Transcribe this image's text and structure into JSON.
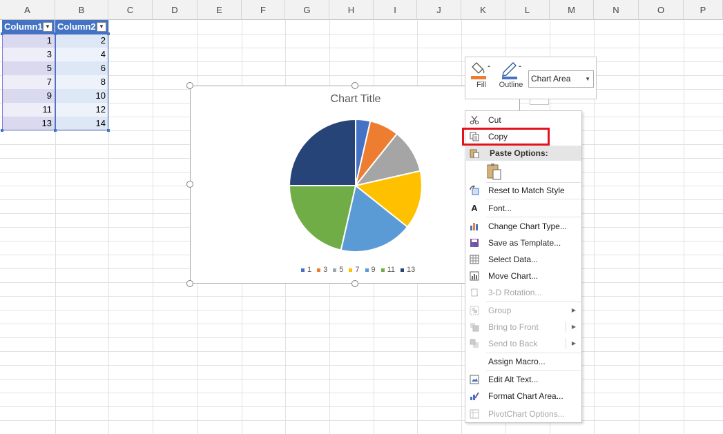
{
  "sheet": {
    "columns": [
      "A",
      "B",
      "C",
      "D",
      "E",
      "F",
      "G",
      "H",
      "I",
      "J",
      "K",
      "L",
      "M",
      "N",
      "O",
      "P"
    ]
  },
  "table": {
    "headers": [
      "Column1",
      "Column2"
    ],
    "rows": [
      [
        "1",
        "2"
      ],
      [
        "3",
        "4"
      ],
      [
        "5",
        "6"
      ],
      [
        "7",
        "8"
      ],
      [
        "9",
        "10"
      ],
      [
        "11",
        "12"
      ],
      [
        "13",
        "14"
      ]
    ]
  },
  "chart_data": {
    "type": "pie",
    "title": "Chart Title",
    "categories": [
      "1",
      "3",
      "5",
      "7",
      "9",
      "11",
      "13"
    ],
    "values": [
      2,
      4,
      6,
      8,
      10,
      12,
      14
    ],
    "colors": [
      "#4472c4",
      "#ed7d31",
      "#a5a5a5",
      "#ffc000",
      "#5b9bd5",
      "#70ad47",
      "#264478"
    ],
    "legend_position": "bottom"
  },
  "mini_toolbar": {
    "fill_label": "Fill",
    "outline_label": "Outline",
    "chart_elements_value": "Chart Area"
  },
  "context_menu": {
    "cut": "Cut",
    "copy": "Copy",
    "paste_options": "Paste Options:",
    "reset_style": "Reset to Match Style",
    "font": "Font...",
    "change_chart_type": "Change Chart Type...",
    "save_as_template": "Save as Template...",
    "select_data": "Select Data...",
    "move_chart": "Move Chart...",
    "rotation_3d": "3-D Rotation...",
    "group": "Group",
    "bring_to_front": "Bring to Front",
    "send_to_back": "Send to Back",
    "assign_macro": "Assign Macro...",
    "edit_alt_text": "Edit Alt Text...",
    "format_chart_area": "Format Chart Area...",
    "pivotchart_options": "PivotChart Options..."
  }
}
